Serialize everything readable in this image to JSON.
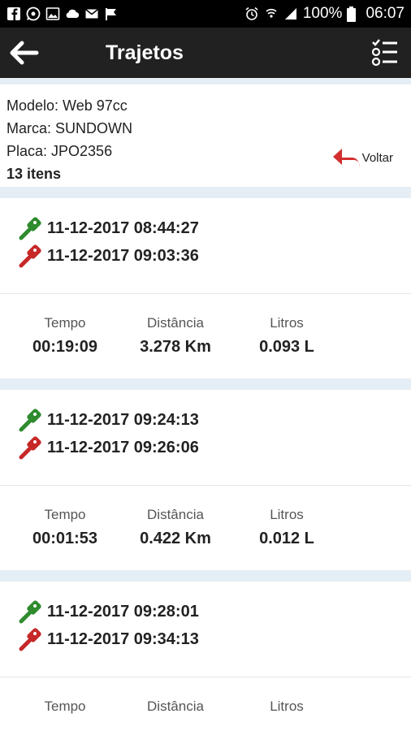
{
  "status": {
    "battery": "100%",
    "time": "06:07"
  },
  "header": {
    "title": "Trajetos"
  },
  "vehicle": {
    "model": "Modelo: Web 97cc",
    "brand": "Marca: SUNDOWN",
    "plate": "Placa: JPO2356",
    "count": "13 itens",
    "back_label": "Voltar"
  },
  "labels": {
    "time": "Tempo",
    "distance": "Distância",
    "liters": "Litros"
  },
  "trips": [
    {
      "start": "11-12-2017 08:44:27",
      "end": "11-12-2017 09:03:36",
      "time": "00:19:09",
      "distance": "3.278 Km",
      "liters": "0.093 L"
    },
    {
      "start": "11-12-2017 09:24:13",
      "end": "11-12-2017 09:26:06",
      "time": "00:01:53",
      "distance": "0.422 Km",
      "liters": "0.012 L"
    },
    {
      "start": "11-12-2017 09:28:01",
      "end": "11-12-2017 09:34:13",
      "time": "",
      "distance": "",
      "liters": ""
    }
  ],
  "colors": {
    "start_key": "#2e8b2e",
    "end_key": "#c62828",
    "back_arrow": "#d32f2f"
  }
}
